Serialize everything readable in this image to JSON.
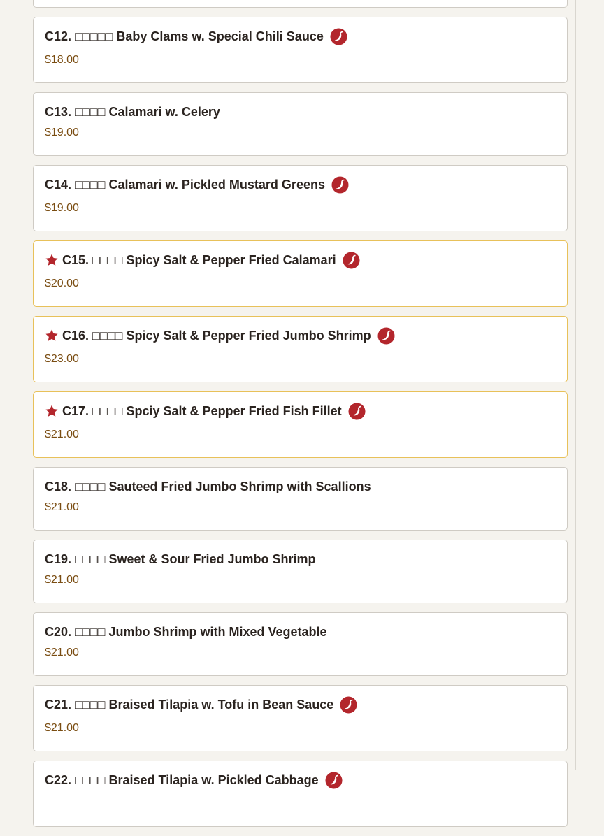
{
  "menu": {
    "items": [
      {
        "name": "",
        "price": "",
        "spicy": false,
        "featured": false
      },
      {
        "name": "C12. □□□□□ Baby Clams w. Special Chili Sauce",
        "price": "$18.00",
        "spicy": true,
        "featured": false
      },
      {
        "name": "C13. □□□□ Calamari w. Celery",
        "price": "$19.00",
        "spicy": false,
        "featured": false
      },
      {
        "name": "C14. □□□□ Calamari w. Pickled Mustard Greens",
        "price": "$19.00",
        "spicy": true,
        "featured": false
      },
      {
        "name": "C15. □□□□ Spicy Salt & Pepper Fried Calamari",
        "price": "$20.00",
        "spicy": true,
        "featured": true
      },
      {
        "name": "C16. □□□□ Spicy Salt & Pepper Fried Jumbo Shrimp",
        "price": "$23.00",
        "spicy": true,
        "featured": true
      },
      {
        "name": "C17. □□□□ Spciy Salt & Pepper Fried Fish Fillet",
        "price": "$21.00",
        "spicy": true,
        "featured": true
      },
      {
        "name": "C18. □□□□ Sauteed Fried Jumbo Shrimp with Scallions",
        "price": "$21.00",
        "spicy": false,
        "featured": false
      },
      {
        "name": "C19. □□□□ Sweet & Sour Fried Jumbo Shrimp",
        "price": "$21.00",
        "spicy": false,
        "featured": false
      },
      {
        "name": "C20. □□□□ Jumbo Shrimp with Mixed Vegetable",
        "price": "$21.00",
        "spicy": false,
        "featured": false
      },
      {
        "name": "C21. □□□□ Braised Tilapia w. Tofu in Bean Sauce",
        "price": "$21.00",
        "spicy": true,
        "featured": false
      },
      {
        "name": "C22. □□□□ Braised Tilapia w. Pickled Cabbage",
        "price": "",
        "spicy": true,
        "featured": false
      }
    ]
  },
  "icons": {
    "spicy": "chili-pepper-icon",
    "featured": "star-icon"
  },
  "colors": {
    "accent_red": "#b3262c",
    "featured_border": "#e8c15a",
    "price": "#7a4d12",
    "title": "#2b2420"
  }
}
